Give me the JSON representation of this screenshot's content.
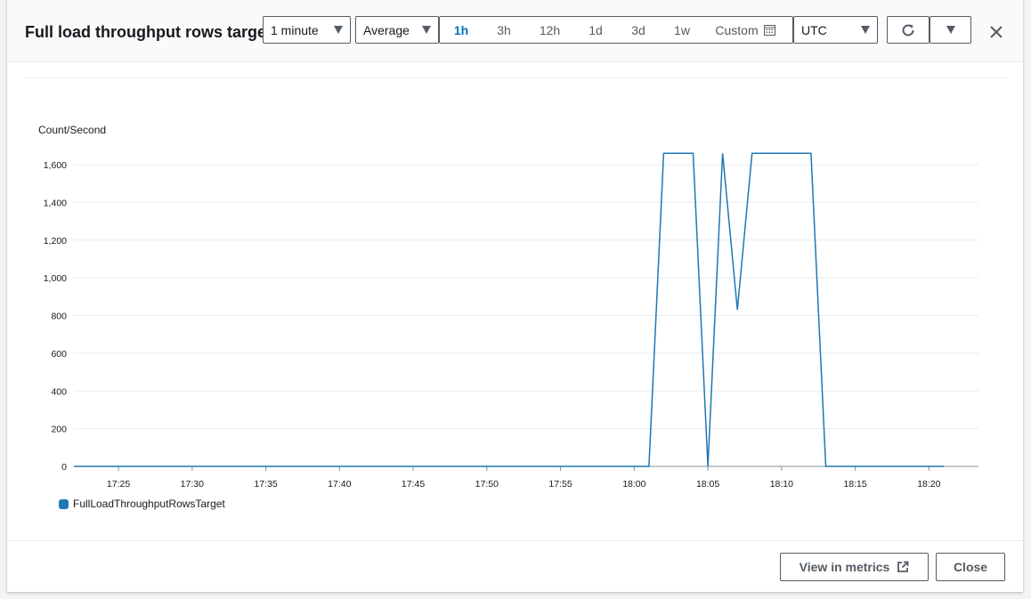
{
  "header": {
    "title": "Full load throughput rows target",
    "period": "1 minute",
    "statistic": "Average",
    "ranges": [
      "1h",
      "3h",
      "12h",
      "1d",
      "3d",
      "1w"
    ],
    "active_range": "1h",
    "custom_label": "Custom",
    "timezone": "UTC"
  },
  "icons": {
    "refresh": "refresh-icon",
    "dropdown": "caret-down-icon",
    "close": "close-icon",
    "calendar": "calendar-icon",
    "external": "external-link-icon"
  },
  "colors": {
    "series": "#1f77b4",
    "active": "#0073bb"
  },
  "footer": {
    "view_metrics": "View in metrics",
    "close": "Close"
  },
  "chart_data": {
    "type": "line",
    "ylabel": "Count/Second",
    "ylim": [
      0,
      1700
    ],
    "yticks": [
      0,
      200,
      400,
      600,
      800,
      1000,
      1200,
      1400,
      1600
    ],
    "ytick_labels": [
      "0",
      "200",
      "400",
      "600",
      "800",
      "1,000",
      "1,200",
      "1,400",
      "1,600"
    ],
    "xlim": [
      "17:23",
      "17:24",
      "18:23"
    ],
    "xticks": [
      "17:25",
      "17:30",
      "17:35",
      "17:40",
      "17:45",
      "17:50",
      "17:55",
      "18:00",
      "18:05",
      "18:10",
      "18:15",
      "18:20"
    ],
    "grid": true,
    "legend": "bottom-left",
    "series": [
      {
        "name": "FullLoadThroughputRowsTarget",
        "color": "#1f77b4",
        "x": [
          "17:23",
          "17:56",
          "18:01",
          "18:02",
          "18:04",
          "18:05",
          "18:06",
          "18:07",
          "18:08",
          "18:12",
          "18:13",
          "18:21"
        ],
        "y": [
          0,
          0,
          0,
          1660,
          1660,
          0,
          1660,
          830,
          1660,
          1660,
          0,
          0
        ]
      }
    ]
  }
}
